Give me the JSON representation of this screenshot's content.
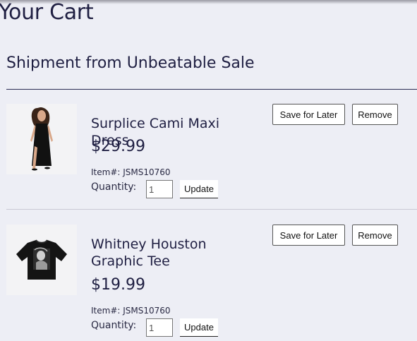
{
  "page": {
    "title": "Your Cart"
  },
  "shipment": {
    "title": "Shipment from Unbeatable Sale"
  },
  "items": [
    {
      "name": "Surplice Cami Maxi Dress",
      "price": "$29.99",
      "sku": "Item#: JSMS10760",
      "quantity_label": "Quantity:",
      "quantity": "1",
      "update_label": "Update",
      "save_label": "Save for Later",
      "remove_label": "Remove",
      "image": "black-maxi-dress-photo"
    },
    {
      "name": "Whitney Houston Graphic Tee",
      "price": "$19.99",
      "sku": "Item#: JSMS10760",
      "quantity_label": "Quantity:",
      "quantity": "1",
      "update_label": "Update",
      "save_label": "Save for Later",
      "remove_label": "Remove",
      "image": "black-graphic-tee-photo"
    }
  ]
}
